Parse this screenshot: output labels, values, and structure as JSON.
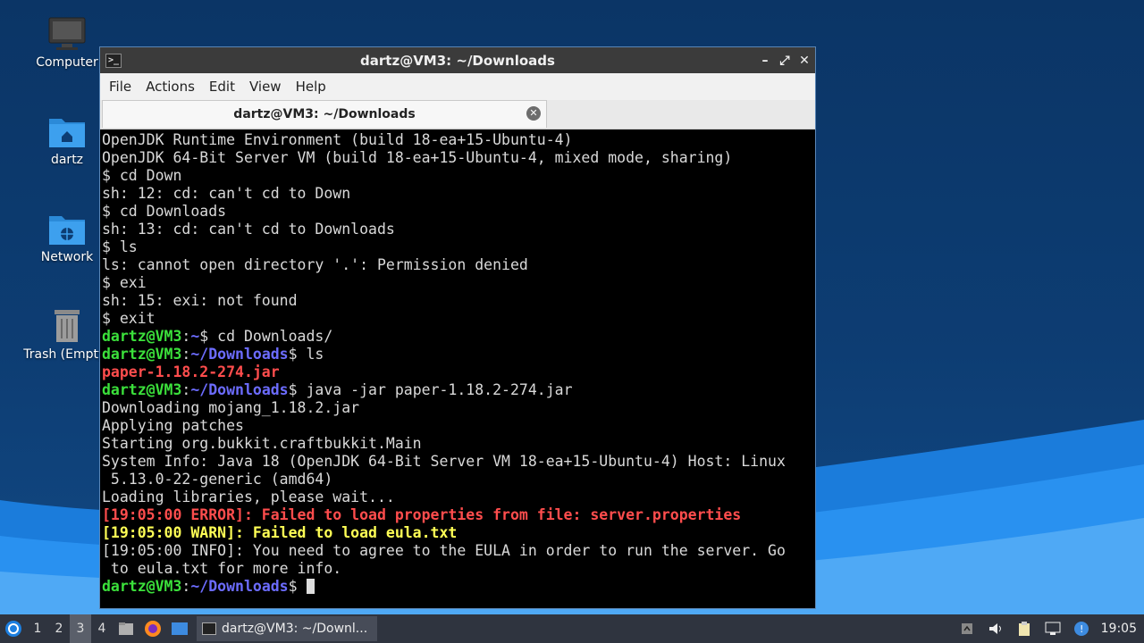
{
  "desktop": {
    "icons": [
      {
        "label": "Computer"
      },
      {
        "label": "dartz"
      },
      {
        "label": "Network"
      },
      {
        "label": "Trash (Empty)"
      }
    ]
  },
  "window": {
    "title": "dartz@VM3: ~/Downloads",
    "menu": [
      "File",
      "Actions",
      "Edit",
      "View",
      "Help"
    ],
    "tab_label": "dartz@VM3: ~/Downloads"
  },
  "terminal": {
    "lines": [
      [
        {
          "t": "OpenJDK Runtime Environment (build 18-ea+15-Ubuntu-4)",
          "c": ""
        }
      ],
      [
        {
          "t": "OpenJDK 64-Bit Server VM (build 18-ea+15-Ubuntu-4, mixed mode, sharing)",
          "c": ""
        }
      ],
      [
        {
          "t": "$ cd Down",
          "c": ""
        }
      ],
      [
        {
          "t": "sh: 12: cd: can't cd to Down",
          "c": ""
        }
      ],
      [
        {
          "t": "$ cd Downloads",
          "c": ""
        }
      ],
      [
        {
          "t": "sh: 13: cd: can't cd to Downloads",
          "c": ""
        }
      ],
      [
        {
          "t": "$ ls",
          "c": ""
        }
      ],
      [
        {
          "t": "ls: cannot open directory '.': Permission denied",
          "c": ""
        }
      ],
      [
        {
          "t": "$ exi",
          "c": ""
        }
      ],
      [
        {
          "t": "sh: 15: exi: not found",
          "c": ""
        }
      ],
      [
        {
          "t": "$ exit",
          "c": ""
        }
      ],
      [
        {
          "t": "dartz@VM3",
          "c": "g"
        },
        {
          "t": ":",
          "c": ""
        },
        {
          "t": "~",
          "c": "b"
        },
        {
          "t": "$ cd Downloads/",
          "c": ""
        }
      ],
      [
        {
          "t": "dartz@VM3",
          "c": "g"
        },
        {
          "t": ":",
          "c": ""
        },
        {
          "t": "~/Downloads",
          "c": "b"
        },
        {
          "t": "$ ls",
          "c": ""
        }
      ],
      [
        {
          "t": "paper-1.18.2-274.jar",
          "c": "r"
        }
      ],
      [
        {
          "t": "dartz@VM3",
          "c": "g"
        },
        {
          "t": ":",
          "c": ""
        },
        {
          "t": "~/Downloads",
          "c": "b"
        },
        {
          "t": "$ java -jar paper-1.18.2-274.jar",
          "c": ""
        }
      ],
      [
        {
          "t": "Downloading mojang_1.18.2.jar",
          "c": ""
        }
      ],
      [
        {
          "t": "Applying patches",
          "c": ""
        }
      ],
      [
        {
          "t": "Starting org.bukkit.craftbukkit.Main",
          "c": ""
        }
      ],
      [
        {
          "t": "System Info: Java 18 (OpenJDK 64-Bit Server VM 18-ea+15-Ubuntu-4) Host: Linux",
          "c": ""
        }
      ],
      [
        {
          "t": " 5.13.0-22-generic (amd64)",
          "c": ""
        }
      ],
      [
        {
          "t": "Loading libraries, please wait...",
          "c": ""
        }
      ],
      [
        {
          "t": "[19:05:00 ERROR]: Failed to load properties from file: server.properties",
          "c": "r"
        }
      ],
      [
        {
          "t": "[19:05:00 WARN]: Failed to load eula.txt",
          "c": "y"
        }
      ],
      [
        {
          "t": "[19:05:00 INFO]: You need to agree to the EULA in order to run the server. Go",
          "c": ""
        }
      ],
      [
        {
          "t": " to eula.txt for more info.",
          "c": ""
        }
      ],
      [
        {
          "t": "dartz@VM3",
          "c": "g"
        },
        {
          "t": ":",
          "c": ""
        },
        {
          "t": "~/Downloads",
          "c": "b"
        },
        {
          "t": "$ ",
          "c": ""
        }
      ]
    ]
  },
  "taskbar": {
    "workspaces": [
      "1",
      "2",
      "3",
      "4"
    ],
    "active_workspace": "3",
    "task_label": "dartz@VM3: ~/Downl...",
    "clock": "19:05"
  },
  "colors": {
    "prompt_user": "#3be03b",
    "prompt_path": "#6c6cff",
    "error": "#ff4d4d",
    "warn": "#ffff55"
  }
}
